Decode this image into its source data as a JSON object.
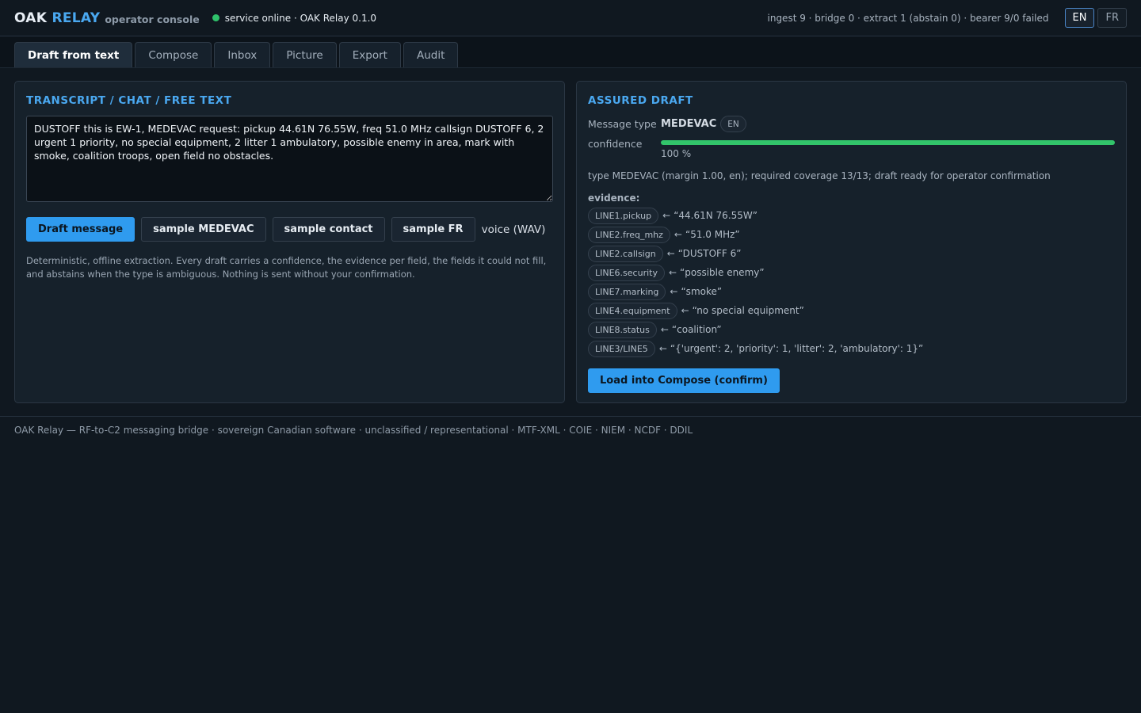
{
  "header": {
    "brand_main": "OAK ",
    "brand_accent": "RELAY",
    "brand_sub": "operator console",
    "status_text": "service online · OAK Relay 0.1.0",
    "counters": "ingest 9 · bridge 0 · extract 1 (abstain 0) · bearer 9/0 failed",
    "lang_en": "EN",
    "lang_fr": "FR",
    "status_color": "#2fc26b"
  },
  "tabs": [
    {
      "label": "Draft from text"
    },
    {
      "label": "Compose"
    },
    {
      "label": "Inbox"
    },
    {
      "label": "Picture"
    },
    {
      "label": "Export"
    },
    {
      "label": "Audit"
    }
  ],
  "left": {
    "title": "TRANSCRIPT / CHAT / FREE TEXT",
    "transcript": "DUSTOFF this is EW-1, MEDEVAC request: pickup 44.61N 76.55W, freq 51.0 MHz callsign DUSTOFF 6, 2 urgent 1 priority, no special equipment, 2 litter 1 ambulatory, possible enemy in area, mark with smoke, coalition troops, open field no obstacles.",
    "draft_button": "Draft message",
    "sample_medevac": "sample MEDEVAC",
    "sample_contact": "sample contact",
    "sample_fr": "sample FR",
    "voice_label": "voice (WAV)",
    "note": "Deterministic, offline extraction. Every draft carries a confidence, the evidence per field, the fields it could not fill, and abstains when the type is ambiguous. Nothing is sent without your confirmation."
  },
  "right": {
    "title": "ASSURED DRAFT",
    "message_type_label": "Message type",
    "message_type": "MEDEVAC",
    "language_pill": "EN",
    "confidence_label": "confidence",
    "confidence_value": "100 %",
    "confidence_fraction": 1.0,
    "summary": "type MEDEVAC (margin 1.00, en); required coverage 13/13; draft ready for operator confirmation",
    "evidence_title": "evidence:",
    "evidence": [
      {
        "key": "LINE1.pickup",
        "value": "“44.61N 76.55W”"
      },
      {
        "key": "LINE2.freq_mhz",
        "value": "“51.0 MHz”"
      },
      {
        "key": "LINE2.callsign",
        "value": "“DUSTOFF 6”"
      },
      {
        "key": "LINE6.security",
        "value": "“possible enemy”"
      },
      {
        "key": "LINE7.marking",
        "value": "“smoke”"
      },
      {
        "key": "LINE4.equipment",
        "value": "“no special equipment”"
      },
      {
        "key": "LINE8.status",
        "value": "“coalition”"
      },
      {
        "key": "LINE3/LINE5",
        "value": "“{'urgent': 2, 'priority': 1, 'litter': 2, 'ambulatory': 1}”"
      }
    ],
    "load_button": "Load into Compose (confirm)"
  },
  "footer": {
    "text": "OAK Relay — RF-to-C2 messaging bridge · sovereign Canadian software · unclassified / representational · MTF-XML · COIE · NIEM · NCDF · DDIL"
  }
}
